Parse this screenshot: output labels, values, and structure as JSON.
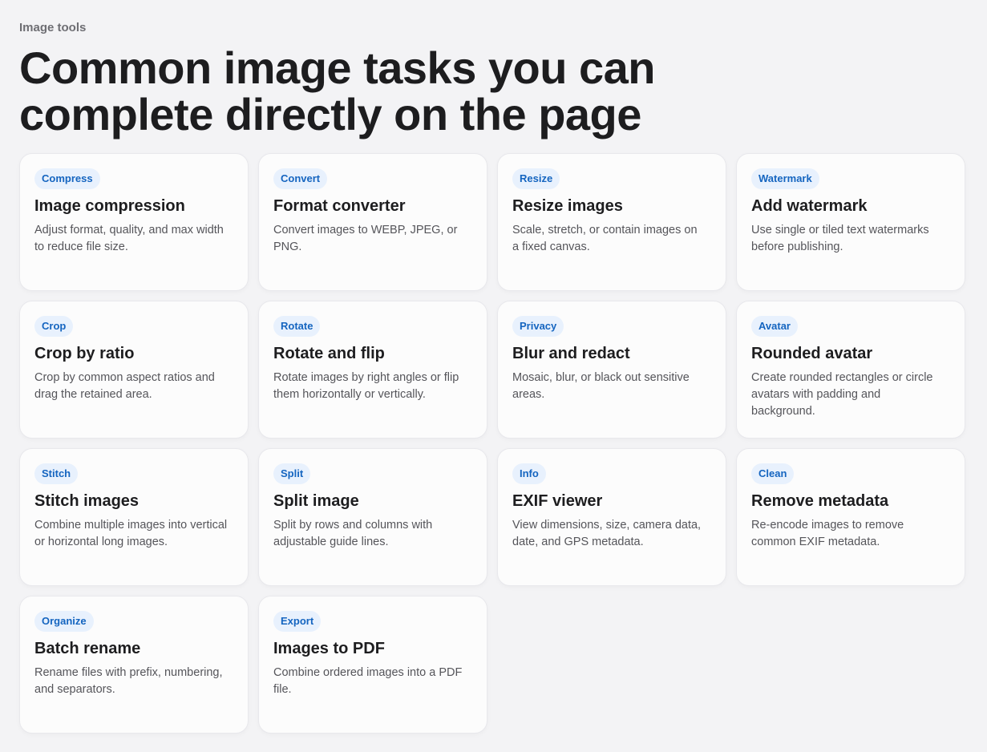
{
  "header": {
    "eyebrow": "Image tools",
    "headline": "Common image tasks you can complete directly on the page"
  },
  "colors": {
    "badge_bg": "#e8f1fd",
    "badge_text": "#1565c0",
    "page_bg": "#f3f3f5"
  },
  "cards": [
    {
      "badge": "Compress",
      "title": "Image compression",
      "desc": "Adjust format, quality, and max width to reduce file size."
    },
    {
      "badge": "Convert",
      "title": "Format converter",
      "desc": "Convert images to WEBP, JPEG, or PNG."
    },
    {
      "badge": "Resize",
      "title": "Resize images",
      "desc": "Scale, stretch, or contain images on a fixed canvas."
    },
    {
      "badge": "Watermark",
      "title": "Add watermark",
      "desc": "Use single or tiled text watermarks before publishing."
    },
    {
      "badge": "Crop",
      "title": "Crop by ratio",
      "desc": "Crop by common aspect ratios and drag the retained area."
    },
    {
      "badge": "Rotate",
      "title": "Rotate and flip",
      "desc": "Rotate images by right angles or flip them horizontally or vertically."
    },
    {
      "badge": "Privacy",
      "title": "Blur and redact",
      "desc": "Mosaic, blur, or black out sensitive areas."
    },
    {
      "badge": "Avatar",
      "title": "Rounded avatar",
      "desc": "Create rounded rectangles or circle avatars with padding and background."
    },
    {
      "badge": "Stitch",
      "title": "Stitch images",
      "desc": "Combine multiple images into vertical or horizontal long images."
    },
    {
      "badge": "Split",
      "title": "Split image",
      "desc": "Split by rows and columns with adjustable guide lines."
    },
    {
      "badge": "Info",
      "title": "EXIF viewer",
      "desc": "View dimensions, size, camera data, date, and GPS metadata."
    },
    {
      "badge": "Clean",
      "title": "Remove metadata",
      "desc": "Re-encode images to remove common EXIF metadata."
    },
    {
      "badge": "Organize",
      "title": "Batch rename",
      "desc": "Rename files with prefix, numbering, and separators."
    },
    {
      "badge": "Export",
      "title": "Images to PDF",
      "desc": "Combine ordered images into a PDF file."
    }
  ]
}
